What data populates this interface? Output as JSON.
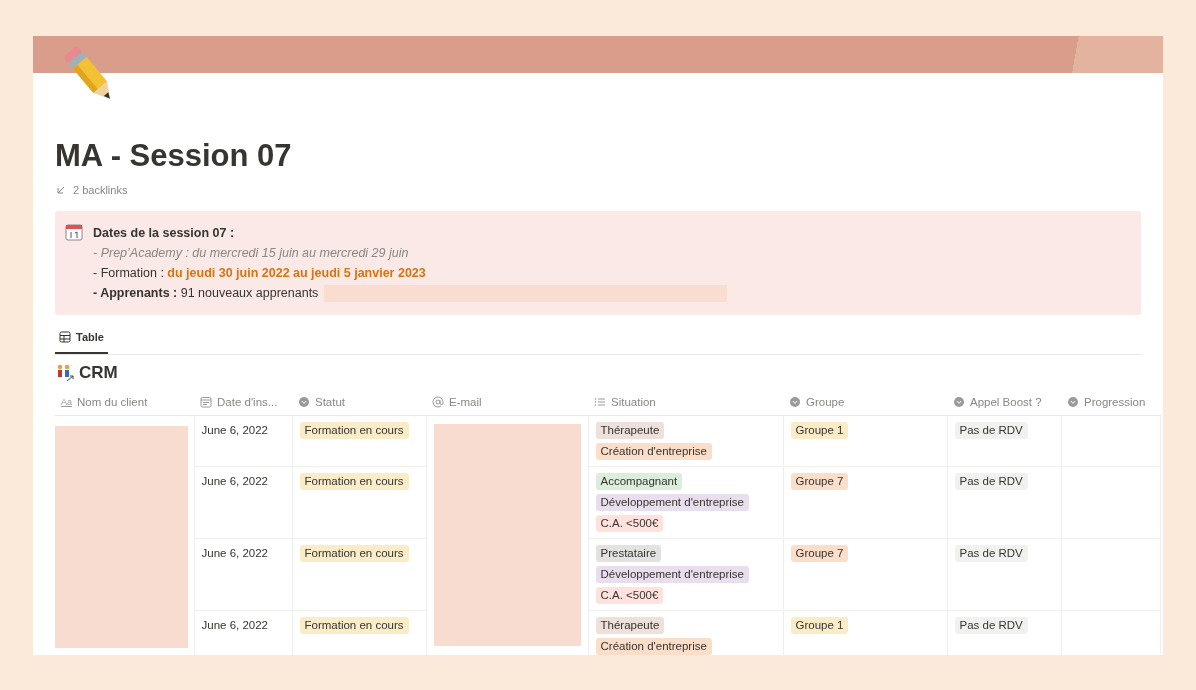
{
  "page": {
    "title": "MA - Session 07",
    "backlinks": "2 backlinks"
  },
  "callout": {
    "heading": "Dates de la session 07 :",
    "lines": [
      {
        "kind": "muted",
        "text": "- Prep’Academy : du mercredi 15 juin au mercredi 29 juin",
        "redacted": false
      },
      {
        "kind": "accent",
        "text": "- Formation : **du jeudi 30 juin 2022 au jeudi 5 janvier 2023**",
        "redacted": false
      },
      {
        "kind": "plain",
        "text": "**- Apprenants :** 91 nouveaux apprenants",
        "redacted": true
      }
    ]
  },
  "tabs": [
    {
      "label": "Table",
      "selected": true
    }
  ],
  "database": {
    "title": "CRM",
    "columns": [
      {
        "label": "Nom du client",
        "kind": "text",
        "glyph": "Aa"
      },
      {
        "label": "Date d'ins...",
        "kind": "date"
      },
      {
        "label": "Statut",
        "kind": "select"
      },
      {
        "label": "E-mail",
        "kind": "email"
      },
      {
        "label": "Situation",
        "kind": "multi"
      },
      {
        "label": "Groupe",
        "kind": "select"
      },
      {
        "label": "Appel Boost ?",
        "kind": "select"
      },
      {
        "label": "Progression",
        "kind": "select"
      }
    ],
    "rows": [
      {
        "date": "June 6, 2022",
        "statut": {
          "label": "Formation en cours",
          "color": "#fbecc8"
        },
        "situation": [
          {
            "label": "Thérapeute",
            "color": "#eee0da"
          },
          {
            "label": "Création d'entreprise",
            "color": "#fadec9"
          }
        ],
        "groupe": {
          "label": "Groupe 1",
          "color": "#fbecc8"
        },
        "appel": {
          "label": "Pas de RDV",
          "color": "#f1f1ef"
        }
      },
      {
        "date": "June 6, 2022",
        "statut": {
          "label": "Formation en cours",
          "color": "#fbecc8"
        },
        "situation": [
          {
            "label": "Accompagnant",
            "color": "#dbeddb"
          },
          {
            "label": "Développement d'entreprise",
            "color": "#e8deee"
          },
          {
            "label": "C.A. <500€",
            "color": "#ffe2dd"
          }
        ],
        "groupe": {
          "label": "Groupe 7",
          "color": "#fadec9"
        },
        "appel": {
          "label": "Pas de RDV",
          "color": "#f1f1ef"
        }
      },
      {
        "date": "June 6, 2022",
        "statut": {
          "label": "Formation en cours",
          "color": "#fbecc8"
        },
        "situation": [
          {
            "label": "Prestataire",
            "color": "#e3e2e0"
          },
          {
            "label": "Développement d'entreprise",
            "color": "#e8deee"
          },
          {
            "label": "C.A. <500€",
            "color": "#ffe2dd"
          }
        ],
        "groupe": {
          "label": "Groupe 7",
          "color": "#fadec9"
        },
        "appel": {
          "label": "Pas de RDV",
          "color": "#f1f1ef"
        }
      },
      {
        "date": "June 6, 2022",
        "statut": {
          "label": "Formation en cours",
          "color": "#fbecc8"
        },
        "situation": [
          {
            "label": "Thérapeute",
            "color": "#eee0da"
          },
          {
            "label": "Création d'entreprise",
            "color": "#fadec9"
          }
        ],
        "groupe": {
          "label": "Groupe 1",
          "color": "#fbecc8"
        },
        "appel": {
          "label": "Pas de RDV",
          "color": "#f1f1ef"
        }
      }
    ]
  }
}
